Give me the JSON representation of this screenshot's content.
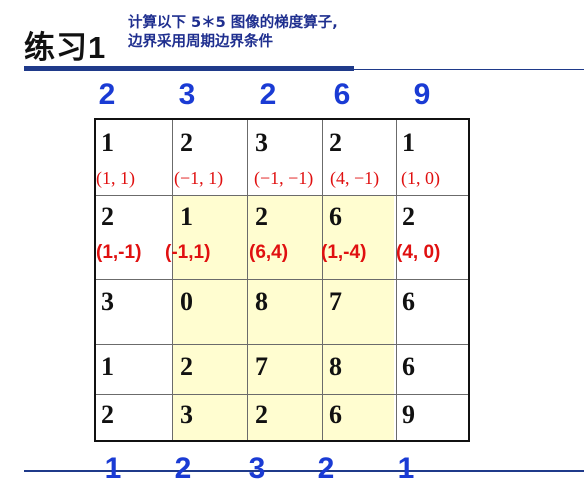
{
  "title": "练习1",
  "subtitle_line1": "计算以下 5＊5 图像的梯度算子,",
  "subtitle_line2": "边界采用周期边界条件",
  "top_numbers": [
    "2",
    "3",
    "2",
    "6",
    "9"
  ],
  "bottom_numbers": [
    "1",
    "2",
    "3",
    "2",
    "1"
  ],
  "grid": {
    "rows": [
      [
        "1",
        "2",
        "3",
        "2",
        "1"
      ],
      [
        "2",
        "1",
        "2",
        "6",
        "2"
      ],
      [
        "3",
        "0",
        "8",
        "7",
        "6"
      ],
      [
        "1",
        "2",
        "7",
        "8",
        "6"
      ],
      [
        "2",
        "3",
        "2",
        "6",
        "9"
      ]
    ]
  },
  "gradients_row1": [
    "(1, 1)",
    "(−1, 1)",
    "(−1, −1)",
    "(4, −1)",
    "(1, 0)"
  ],
  "gradients_row2": [
    "(1,-1)",
    "(-1,1)",
    "(6,4)",
    "(1,-4)",
    "(4, 0)"
  ],
  "colors": {
    "title_text": "#111111",
    "subtitle_text": "#1f2f8f",
    "accent_blue": "#1a3bd4",
    "gradient_red": "#e01010",
    "highlight": "#fffdd0"
  }
}
